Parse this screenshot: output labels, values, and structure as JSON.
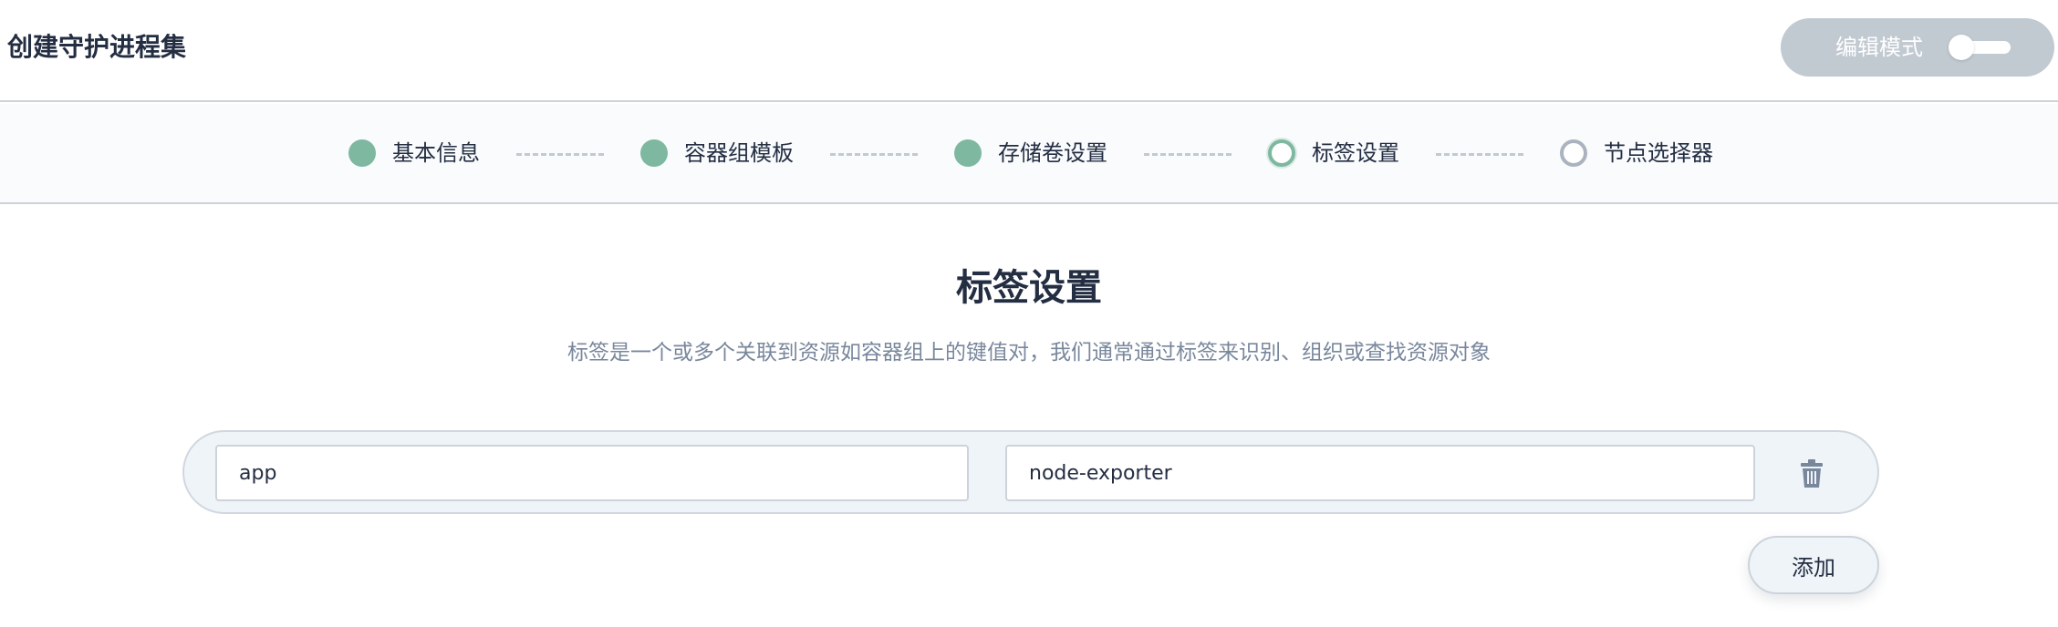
{
  "header": {
    "title": "创建守护进程集",
    "edit_mode_label": "编辑模式",
    "edit_mode_on": false
  },
  "steps": [
    {
      "label": "基本信息",
      "status": "done"
    },
    {
      "label": "容器组模板",
      "status": "done"
    },
    {
      "label": "存储卷设置",
      "status": "done"
    },
    {
      "label": "标签设置",
      "status": "current"
    },
    {
      "label": "节点选择器",
      "status": "todo"
    }
  ],
  "main": {
    "title": "标签设置",
    "description": "标签是一个或多个关联到资源如容器组上的键值对，我们通常通过标签来识别、组织或查找资源对象",
    "labels": [
      {
        "key": "app",
        "value": "node-exporter"
      }
    ],
    "add_button_label": "添加"
  },
  "colors": {
    "done": "#7eb8a0",
    "todo": "#abb4be",
    "text": "#242e42",
    "muted": "#79879c"
  },
  "icons": {
    "delete": "trash-icon"
  }
}
